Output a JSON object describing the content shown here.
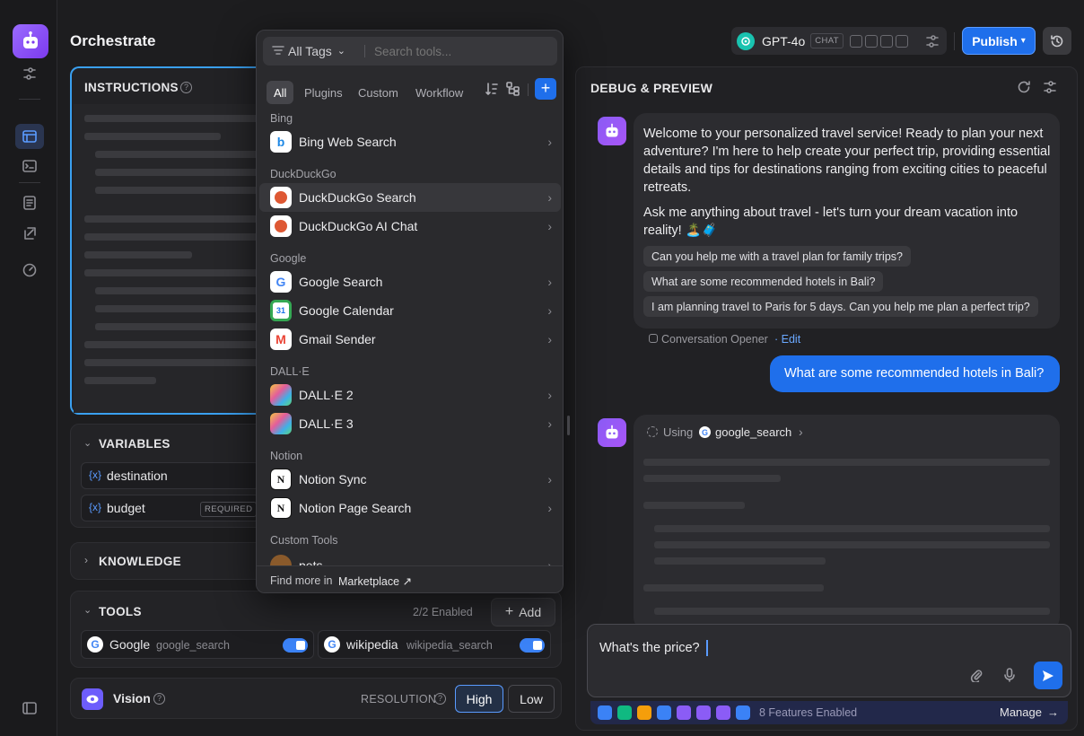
{
  "app": {
    "title": "Orchestrate"
  },
  "model": {
    "name": "GPT-4o",
    "badge": "CHAT"
  },
  "header": {
    "publish_label": "Publish"
  },
  "instructions": {
    "title": "INSTRUCTIONS"
  },
  "variables": {
    "title": "VARIABLES",
    "items": [
      {
        "name": "destination",
        "required": ""
      },
      {
        "name": "budget",
        "required": "REQUIRED"
      }
    ]
  },
  "knowledge": {
    "title": "KNOWLEDGE"
  },
  "tools": {
    "title": "TOOLS",
    "enabled_count": "2/2 Enabled",
    "add_label": "Add",
    "items": [
      {
        "name": "Google",
        "id": "google_search",
        "enabled": true
      },
      {
        "name": "wikipedia",
        "id": "wikipedia_search",
        "enabled": true
      }
    ]
  },
  "vision": {
    "title": "Vision",
    "resolution_label": "RESOLUTION",
    "high": "High",
    "low": "Low",
    "selected": "High"
  },
  "tool_picker": {
    "tag_filter": "All Tags",
    "search_placeholder": "Search tools...",
    "tabs": [
      "All",
      "Plugins",
      "Custom",
      "Workflow"
    ],
    "active_tab": "All",
    "groups": [
      {
        "name": "Bing",
        "items": [
          "Bing Web Search"
        ]
      },
      {
        "name": "DuckDuckGo",
        "items": [
          "DuckDuckGo Search",
          "DuckDuckGo AI Chat"
        ]
      },
      {
        "name": "Google",
        "items": [
          "Google Search",
          "Google Calendar",
          "Gmail Sender"
        ]
      },
      {
        "name": "DALL·E",
        "items": [
          "DALL·E 2",
          "DALL·E 3"
        ]
      },
      {
        "name": "Notion",
        "items": [
          "Notion Sync",
          "Notion Page Search"
        ]
      },
      {
        "name": "Custom Tools",
        "items": [
          "pets"
        ]
      }
    ],
    "highlighted": "DuckDuckGo Search",
    "footer_prefix": "Find more in",
    "footer_link": "Marketplace ↗"
  },
  "preview": {
    "title": "DEBUG & PREVIEW",
    "welcome_p1": "Welcome to your personalized travel service! Ready to plan your next adventure? I'm here to help create your perfect trip, providing essential details and tips for destinations ranging from exciting cities to peaceful retreats.",
    "welcome_p2": "Ask me anything about travel - let's turn your dream vacation into reality! 🏝️🧳",
    "suggestions": [
      "Can you help me with a travel plan for family trips?",
      "What are some recommended hotels in Bali?",
      "I am planning travel to Paris for 5 days. Can you help me plan a perfect trip?"
    ],
    "opener_label": "Conversation Opener",
    "opener_edit": "· Edit",
    "user_message": "What are some recommended hotels in Bali?",
    "using_label": "Using",
    "using_tool": "google_search"
  },
  "composer": {
    "value": "What's the price?",
    "features_label": "8 Features Enabled",
    "manage_label": "Manage"
  },
  "colors": {
    "accent": "#1f6feb",
    "purple": "#8b5cf6",
    "toggle": "#3b82f6"
  }
}
